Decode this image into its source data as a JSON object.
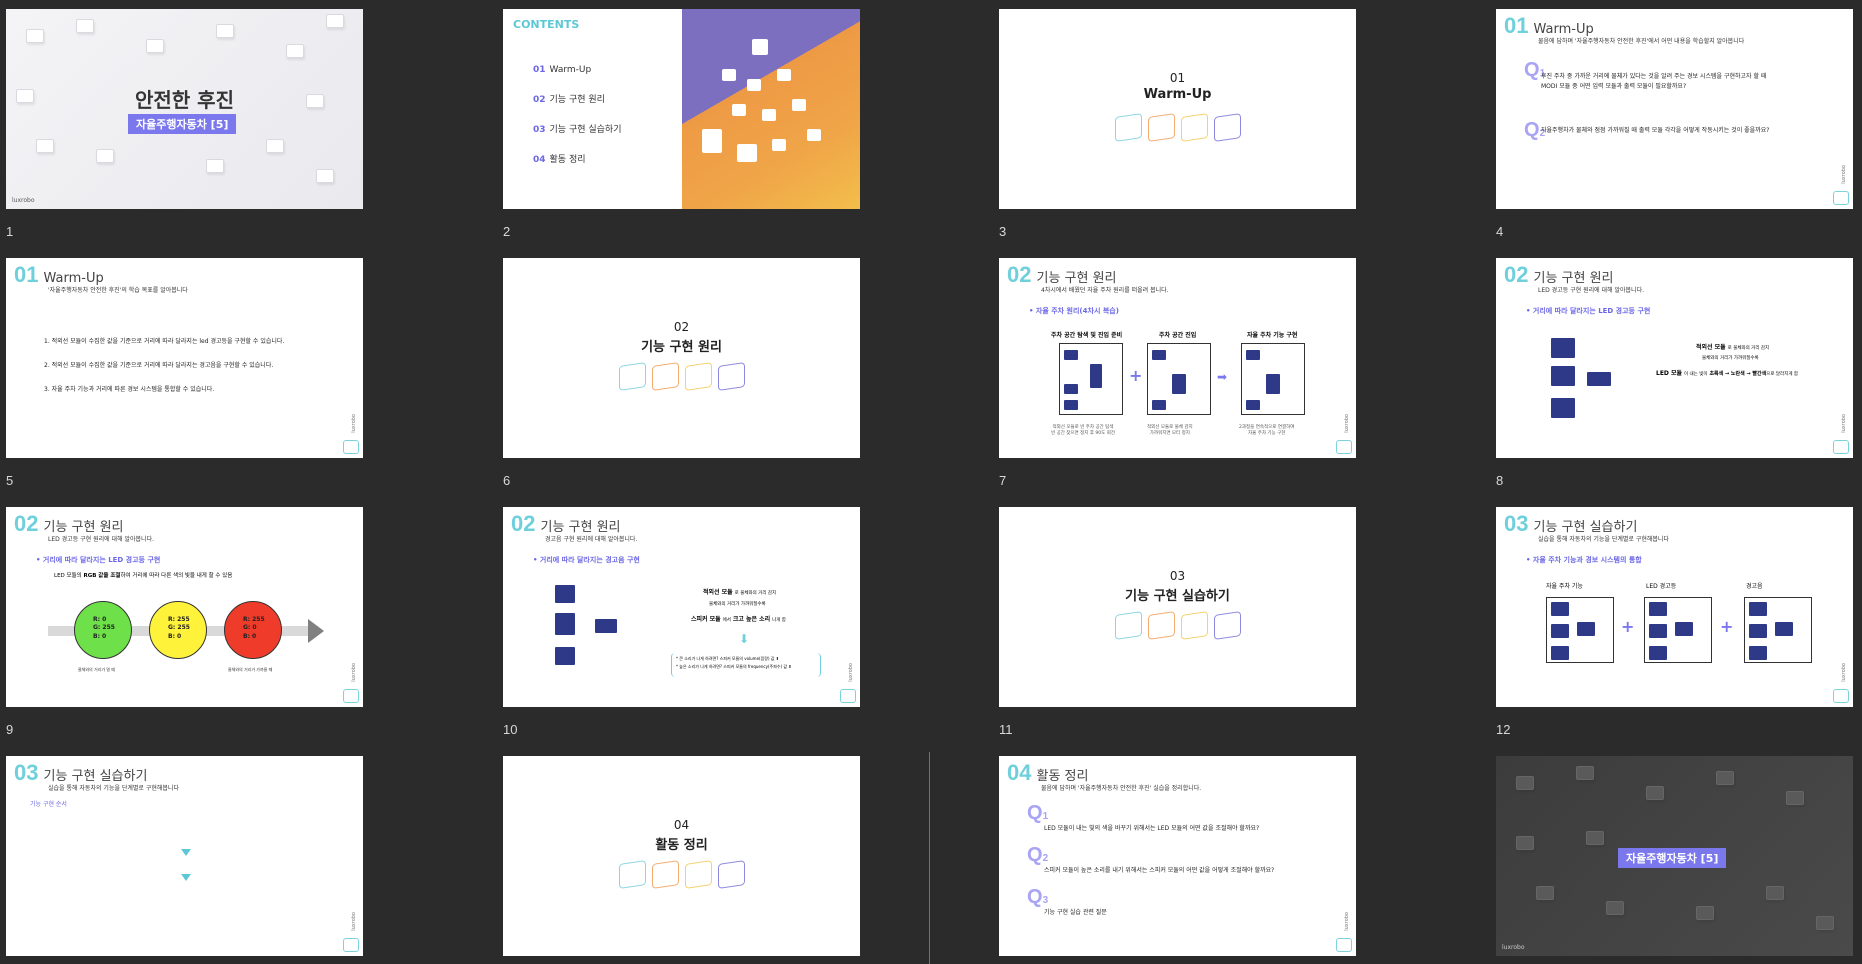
{
  "slides": [
    {
      "num": "1",
      "title": "안전한 후진",
      "badge": "자율주행자동차 [5]",
      "logo": "luxrobo"
    },
    {
      "num": "2",
      "contents": "CONTENTS",
      "items": [
        {
          "n": "01",
          "t": "Warm-Up"
        },
        {
          "n": "02",
          "t": "기능 구현 원리"
        },
        {
          "n": "03",
          "t": "기능 구현 실습하기"
        },
        {
          "n": "04",
          "t": "활동 정리"
        }
      ]
    },
    {
      "num": "3",
      "n": "01",
      "t": "Warm-Up"
    },
    {
      "num": "4",
      "n": "01",
      "t": "Warm-Up",
      "sub": "물음에 답하며 '자율주행자동차 안전한 후진'에서 어떤 내용을 학습할지 알아봅니다",
      "q1": "후진 주차 중 가까운 거리에 물체가 있다는 것을 알려 주는 경보 시스템을 구현하고자 할 때\nMODI 모듈 중 어떤 입력 모듈과 출력 모듈이 필요할까요?",
      "q2": "자율주행차가 물체와 점점 가까워질 때 출력 모듈 각각을 어떻게 작동시키는 것이 좋을까요?",
      "page": "4"
    },
    {
      "num": "5",
      "n": "01",
      "t": "Warm-Up",
      "sub": "'자율주행자동차 안전한 후진'의 학습 목표를 알아봅니다",
      "goals": [
        "1.  적외선 모듈이 수집한 값을 기준으로 거리에 따라 달라지는 led 경고등을 구현할 수 있습니다.",
        "2.  적외선 모듈이 수집한 값을 기준으로 거리에 따라 달라지는 경고음을 구현할 수 있습니다.",
        "3.  자율 주차 기능과 거리에 따른 경보 시스템을 통합할 수 있습니다."
      ],
      "page": "5"
    },
    {
      "num": "6",
      "n": "02",
      "t": "기능 구현 원리"
    },
    {
      "num": "7",
      "n": "02",
      "t": "기능 구현 원리",
      "sub": "4차시에서 배웠던 자율 주차 원리를 떠올려 봅니다.",
      "bullet": "자율 주차 원리(4차시 복습)",
      "c1": "주차 공간 탐색 및 진입 준비",
      "c2": "주차 공간 진입",
      "c3": "자율 주차 기능 구현",
      "d1": "적외선 모듈로 빈 주차 공간 탐색\n빈 공간 찾으면 정지 후 90도 회전",
      "d2": "적외선 모듈로 물체 감지\n가까워지면 모터 정지",
      "d3": "2과정을 연속적으로 연결하여\n자율 주차 기능 구현",
      "page": "7"
    },
    {
      "num": "8",
      "n": "02",
      "t": "기능 구현 원리",
      "sub": "LED 경고등 구현 원리에 대해 알아봅니다.",
      "bullet": "거리에 따라 달라지는 LED 경고등 구현",
      "r1": "적외선 모듈",
      "r1b": "로 물체와의 거리 감지",
      "r2": "물체와의 거리가 가까워질수록",
      "r3": "LED 모듈",
      "r3b": "이 내는 빛이",
      "r3c": "초록색 → 노란색 → 빨간색",
      "r3d": "으로 달라지게 함",
      "page": "8"
    },
    {
      "num": "9",
      "n": "02",
      "t": "기능 구현 원리",
      "sub": "LED 경고등 구현 원리에 대해 알아봅니다.",
      "bullet": "거리에 따라 달라지는 LED 경고등 구현",
      "line1a": "LED 모듈의 ",
      "line1b": "RGB 값을 조절",
      "line1c": "하여 거리에 따라 다른 색의 빛을 내게 할 수 있음",
      "c1": "R: 0\nG: 255\nB: 0",
      "c2": "R: 255\nG: 255\nB: 0",
      "c3": "R: 255\nG: 0\nB: 0",
      "far": "물체와의 거리가 멀 때",
      "near": "물체와의 거리가 가까울 때",
      "page": "9"
    },
    {
      "num": "10",
      "n": "02",
      "t": "기능 구현 원리",
      "sub": "경고음 구현 원리에 대해 알아봅니다.",
      "bullet": "거리에 따라 달라지는 경고음 구현",
      "r1": "적외선 모듈",
      "r1b": "로 물체와의 거리 감지",
      "r2": "물체와의 거리가 가까워질수록",
      "r3": "스피커 모듈",
      "r3b": "에서",
      "r3c": "크고 높은 소리",
      "r3d": "나게 함",
      "n1": "* 큰 소리가 나게 하려면? 스피커 모듈의 volume(음량) 값 ⬆",
      "n2": "* 높은 소리가 나게 하려면? 스피커 모듈의 frequency(주파수) 값 ⬆",
      "page": "10"
    },
    {
      "num": "11",
      "n": "03",
      "t": "기능 구현 실습하기"
    },
    {
      "num": "12",
      "n": "03",
      "t": "기능 구현 실습하기",
      "sub": "실습을 통해 자동차의 기능을 단계별로 구현해봅니다",
      "bullet": "자율 주차 기능과 경보 시스템의 통합",
      "c1": "자율 주차 기능",
      "c2": "LED 경고등",
      "c3": "경고음",
      "page": "12"
    },
    {
      "num": "13",
      "n": "03",
      "t": "기능 구현 실습하기",
      "sub": "실습을 통해 자동차의 기능을 단계별로 구현해봅니다",
      "bullet": "기능 구현 순서",
      "page": "13"
    },
    {
      "num": "14",
      "n": "04",
      "t": "활동 정리"
    },
    {
      "num": "15",
      "n": "04",
      "t": "활동 정리",
      "sub": "물음에 답하며 '자율주행자동차 안전한 후진' 실습을 정리합니다.",
      "q1": "LED 모듈이 내는 빛의 색을 바꾸기 위해서는 LED 모듈의 어떤 값을 조절해야 할까요?",
      "q2": "스피커 모듈이 높은 소리를 내기 위해서는 스피커 모듈의 어떤 값을 어떻게 조절해야 할까요?",
      "q3": "기능 구현 실습 관련 질문",
      "page": "15"
    },
    {
      "num": "16",
      "badge": "자율주행자동차 [5]",
      "logo": "luxrobo"
    }
  ],
  "colors": {
    "accent": "#7b78ee",
    "teal": "#6fd0dc",
    "bg": "#2b2b2b"
  }
}
